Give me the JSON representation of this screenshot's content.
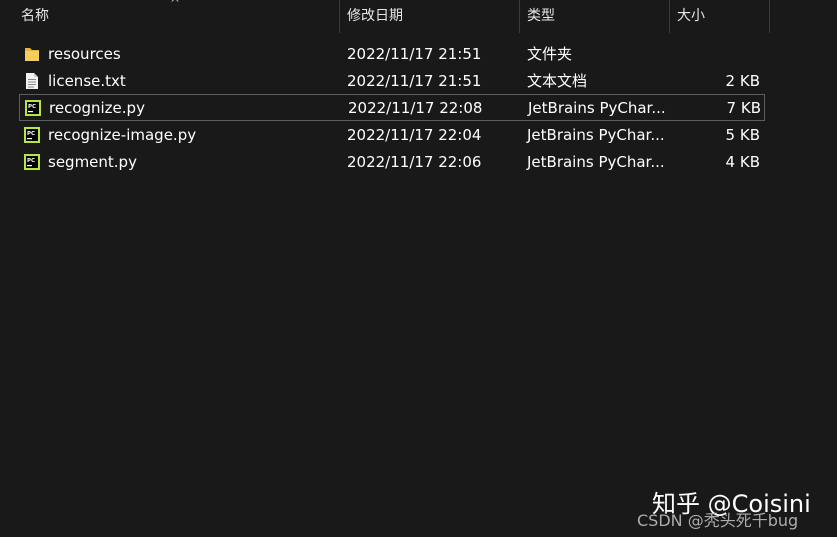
{
  "columns": {
    "name": "名称",
    "date": "修改日期",
    "type": "类型",
    "size": "大小"
  },
  "files": [
    {
      "name": "resources",
      "date": "2022/11/17 21:51",
      "type": "文件夹",
      "size": "",
      "icon": "folder-icon"
    },
    {
      "name": "license.txt",
      "date": "2022/11/17 21:51",
      "type": "文本文档",
      "size": "2 KB",
      "icon": "text-file-icon"
    },
    {
      "name": "recognize.py",
      "date": "2022/11/17 22:08",
      "type": "JetBrains PyChar...",
      "size": "7 KB",
      "icon": "pycharm-icon",
      "selected": true
    },
    {
      "name": "recognize-image.py",
      "date": "2022/11/17 22:04",
      "type": "JetBrains PyChar...",
      "size": "5 KB",
      "icon": "pycharm-icon"
    },
    {
      "name": "segment.py",
      "date": "2022/11/17 22:06",
      "type": "JetBrains PyChar...",
      "size": "4 KB",
      "icon": "pycharm-icon"
    }
  ],
  "watermark": {
    "zhihu": "知乎 @Coisini",
    "csdn": "CSDN @秃头死千bug"
  },
  "colors": {
    "background": "#191919",
    "folder": "#f0c24a",
    "pycharm_green": "#21d789",
    "selection_border": "#5f5f5f"
  }
}
